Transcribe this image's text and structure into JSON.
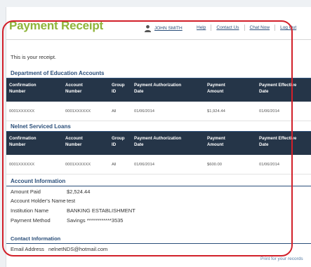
{
  "header": {
    "title": "Payment Receipt",
    "user_name": "JOHN SMITH",
    "nav": [
      "Help",
      "Contact Us",
      "Chat Now",
      "Log Out"
    ]
  },
  "intro": "This is your receipt.",
  "table_headers": [
    [
      "Confirmation",
      "Number"
    ],
    [
      "Account",
      "Number"
    ],
    [
      "Group",
      "ID"
    ],
    [
      "Payment Authorization",
      "Date"
    ],
    [
      "Payment",
      "Amount"
    ],
    [
      "Payment Effective",
      "Date"
    ]
  ],
  "education": {
    "title": "Department of Education Accounts",
    "row": [
      "0001XXXXXX",
      "0001XXXXXX",
      "All",
      "01/06/2014",
      "$1,924.44",
      "01/06/2014"
    ]
  },
  "nelnet": {
    "title": "Nelnet Serviced Loans",
    "row": [
      "0001XXXXXX",
      "0001XXXXXX",
      "All",
      "01/06/2014",
      "$600.00",
      "01/06/2014"
    ]
  },
  "account": {
    "title": "Account Information",
    "rows": [
      {
        "label": "Amount Paid",
        "value": "$2,524.44"
      },
      {
        "label": "Account Holder's Name",
        "value": "test"
      },
      {
        "label": "Institution Name",
        "value": "BANKING ESTABLISHMENT"
      },
      {
        "label": "Payment Method",
        "value": "Savings ************3535"
      }
    ]
  },
  "contact": {
    "title": "Contact Information",
    "label": "Email Address",
    "value": "nelnetNDS@hotmail.com"
  },
  "print_text": "Print for your records",
  "colors": {
    "title_green": "#8fb43a",
    "navy": "#2b4f7a",
    "table_header": "#253548",
    "highlight_red": "#d2202a"
  }
}
